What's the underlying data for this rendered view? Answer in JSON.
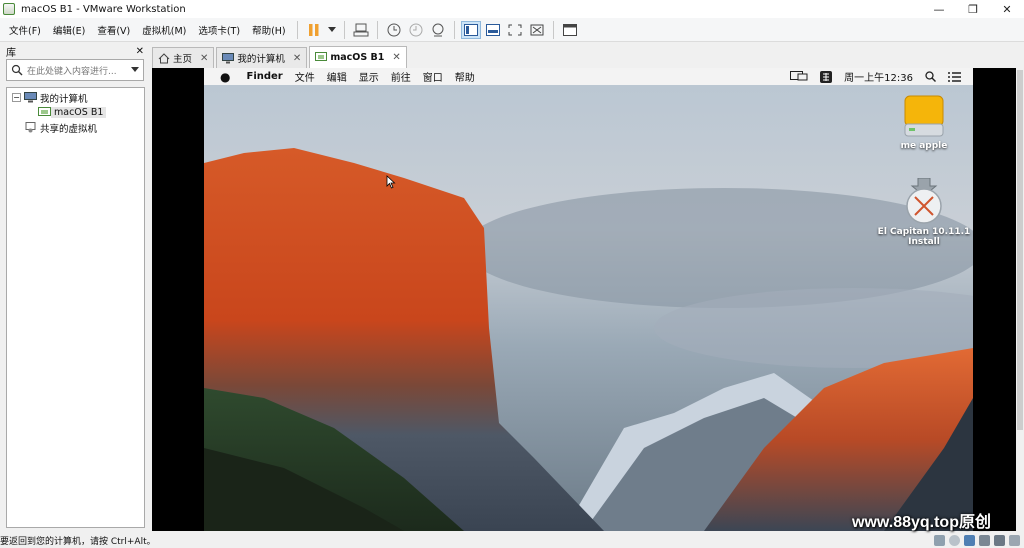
{
  "window": {
    "title": "macOS B1 - VMware Workstation",
    "controls": [
      "—",
      "❐",
      "✕"
    ]
  },
  "menubar": {
    "items": [
      "文件(F)",
      "编辑(E)",
      "查看(V)",
      "虚拟机(M)",
      "选项卡(T)",
      "帮助(H)"
    ]
  },
  "toolbar": {
    "buttons": [
      "pause-icon",
      "dropdown-arrow-icon",
      "send-ctrl-alt-del-icon",
      "snapshot-take-icon",
      "snapshot-revert-icon",
      "snapshot-manager-icon",
      "view-console-icon",
      "view-unity-icon",
      "view-fullscreen-icon",
      "view-stretch-icon",
      "view-library-icon"
    ],
    "accent": "#f0a030"
  },
  "library": {
    "title": "库",
    "close": "✕",
    "search_placeholder": "在此处键入内容进行...",
    "tree": [
      {
        "label": "我的计算机",
        "level": 0,
        "expander": "−"
      },
      {
        "label": "macOS B1",
        "level": 1,
        "selected": true
      },
      {
        "label": "共享的虚拟机",
        "level": 0
      }
    ]
  },
  "tabs": [
    {
      "label": "主页",
      "icon": "home-icon",
      "close": "✕"
    },
    {
      "label": "我的计算机",
      "icon": "computer-icon",
      "close": "✕"
    },
    {
      "label": "macOS B1",
      "icon": "vm-icon",
      "close": "✕",
      "active": true
    }
  ],
  "guest": {
    "menubar": {
      "apple": "",
      "items": [
        "Finder",
        "文件",
        "编辑",
        "显示",
        "前往",
        "窗口",
        "帮助"
      ],
      "clock": "周一上午12:36"
    },
    "desktop_icons": [
      {
        "label": "me apple",
        "icon": "hard-drive-icon"
      },
      {
        "label": "El Capitan 10.11.1",
        "label2": "Install",
        "icon": "installer-icon"
      }
    ]
  },
  "statusbar": {
    "text": "要返回到您的计算机，请按 Ctrl+Alt。"
  },
  "watermark": "www.88yq.top原创"
}
